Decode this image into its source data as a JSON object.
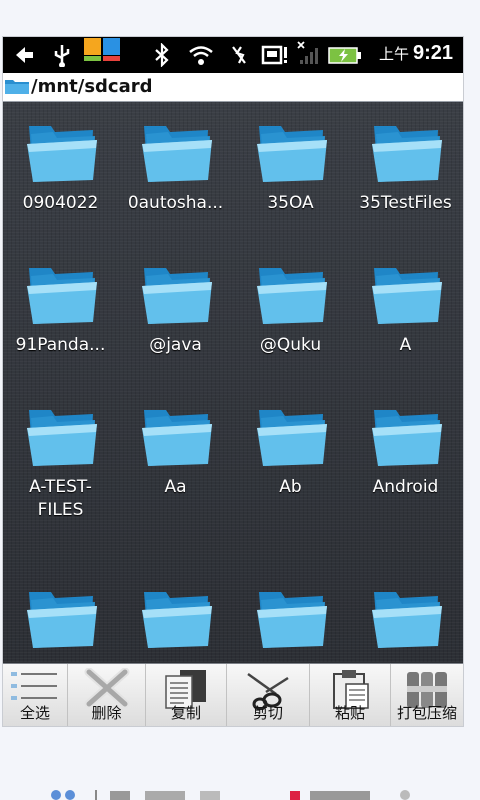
{
  "status_bar": {
    "ampm": "上午",
    "time": "9:21",
    "icons": [
      "back-icon",
      "usb-icon",
      "app-icon",
      "bluetooth-icon",
      "wifi-icon",
      "no-signal-icon",
      "sd-alert-icon",
      "signal-icon",
      "battery-charging-icon"
    ]
  },
  "path_bar": {
    "path": "/mnt/sdcard"
  },
  "folders": [
    {
      "label": "0904022"
    },
    {
      "label": "0autosha..."
    },
    {
      "label": "35OA"
    },
    {
      "label": "35TestFiles"
    },
    {
      "label": "91Panda..."
    },
    {
      "label": "@java"
    },
    {
      "label": "@Quku"
    },
    {
      "label": "A"
    },
    {
      "label": "A-TEST-FILES"
    },
    {
      "label": "Aa"
    },
    {
      "label": "Ab"
    },
    {
      "label": "Android"
    },
    {
      "label": ""
    },
    {
      "label": ""
    },
    {
      "label": ""
    },
    {
      "label": ""
    }
  ],
  "toolbar": {
    "select_all": "全选",
    "delete": "删除",
    "copy": "复制",
    "cut": "剪切",
    "paste": "粘贴",
    "compress": "打包压缩"
  },
  "colors": {
    "folder_light": "#7fd0f2",
    "folder_dark": "#2a93d1",
    "background": "#2c2f35"
  }
}
